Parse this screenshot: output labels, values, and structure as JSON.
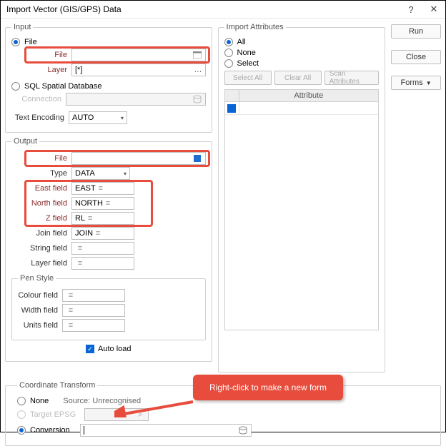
{
  "window": {
    "title": "Import Vector (GIS/GPS) Data",
    "help": "?",
    "close": "✕"
  },
  "input": {
    "legend": "Input",
    "file_opt": "File",
    "file_lbl": "File",
    "file_val": "",
    "layer_lbl": "Layer",
    "layer_val": "[*]",
    "sql_opt": "SQL Spatial Database",
    "conn_lbl": "Connection",
    "enc_lbl": "Text Encoding",
    "enc_val": "AUTO"
  },
  "output": {
    "legend": "Output",
    "file_lbl": "File",
    "file_val": "",
    "type_lbl": "Type",
    "type_val": "DATA",
    "east_lbl": "East field",
    "east_val": "EAST",
    "north_lbl": "North field",
    "north_val": "NORTH",
    "z_lbl": "Z field",
    "z_val": "RL",
    "join_lbl": "Join field",
    "join_val": "JOIN",
    "str_lbl": "String field",
    "lay_lbl": "Layer field",
    "pen_legend": "Pen Style",
    "col_lbl": "Colour field",
    "wid_lbl": "Width field",
    "uni_lbl": "Units field",
    "auto_lbl": "Auto load"
  },
  "attrs": {
    "legend": "Import Attributes",
    "all": "All",
    "none": "None",
    "select": "Select",
    "selall": "Select All",
    "clrall": "Clear All",
    "scan": "Scan Attributes",
    "header": "Attribute"
  },
  "buttons": {
    "run": "Run",
    "close": "Close",
    "forms": "Forms"
  },
  "coord": {
    "legend": "Coordinate Transform",
    "none": "None",
    "source": "Source: Unrecognised",
    "tgt": "Target EPSG",
    "conv": "Conversion"
  },
  "callout": "Right-click to make a new form"
}
